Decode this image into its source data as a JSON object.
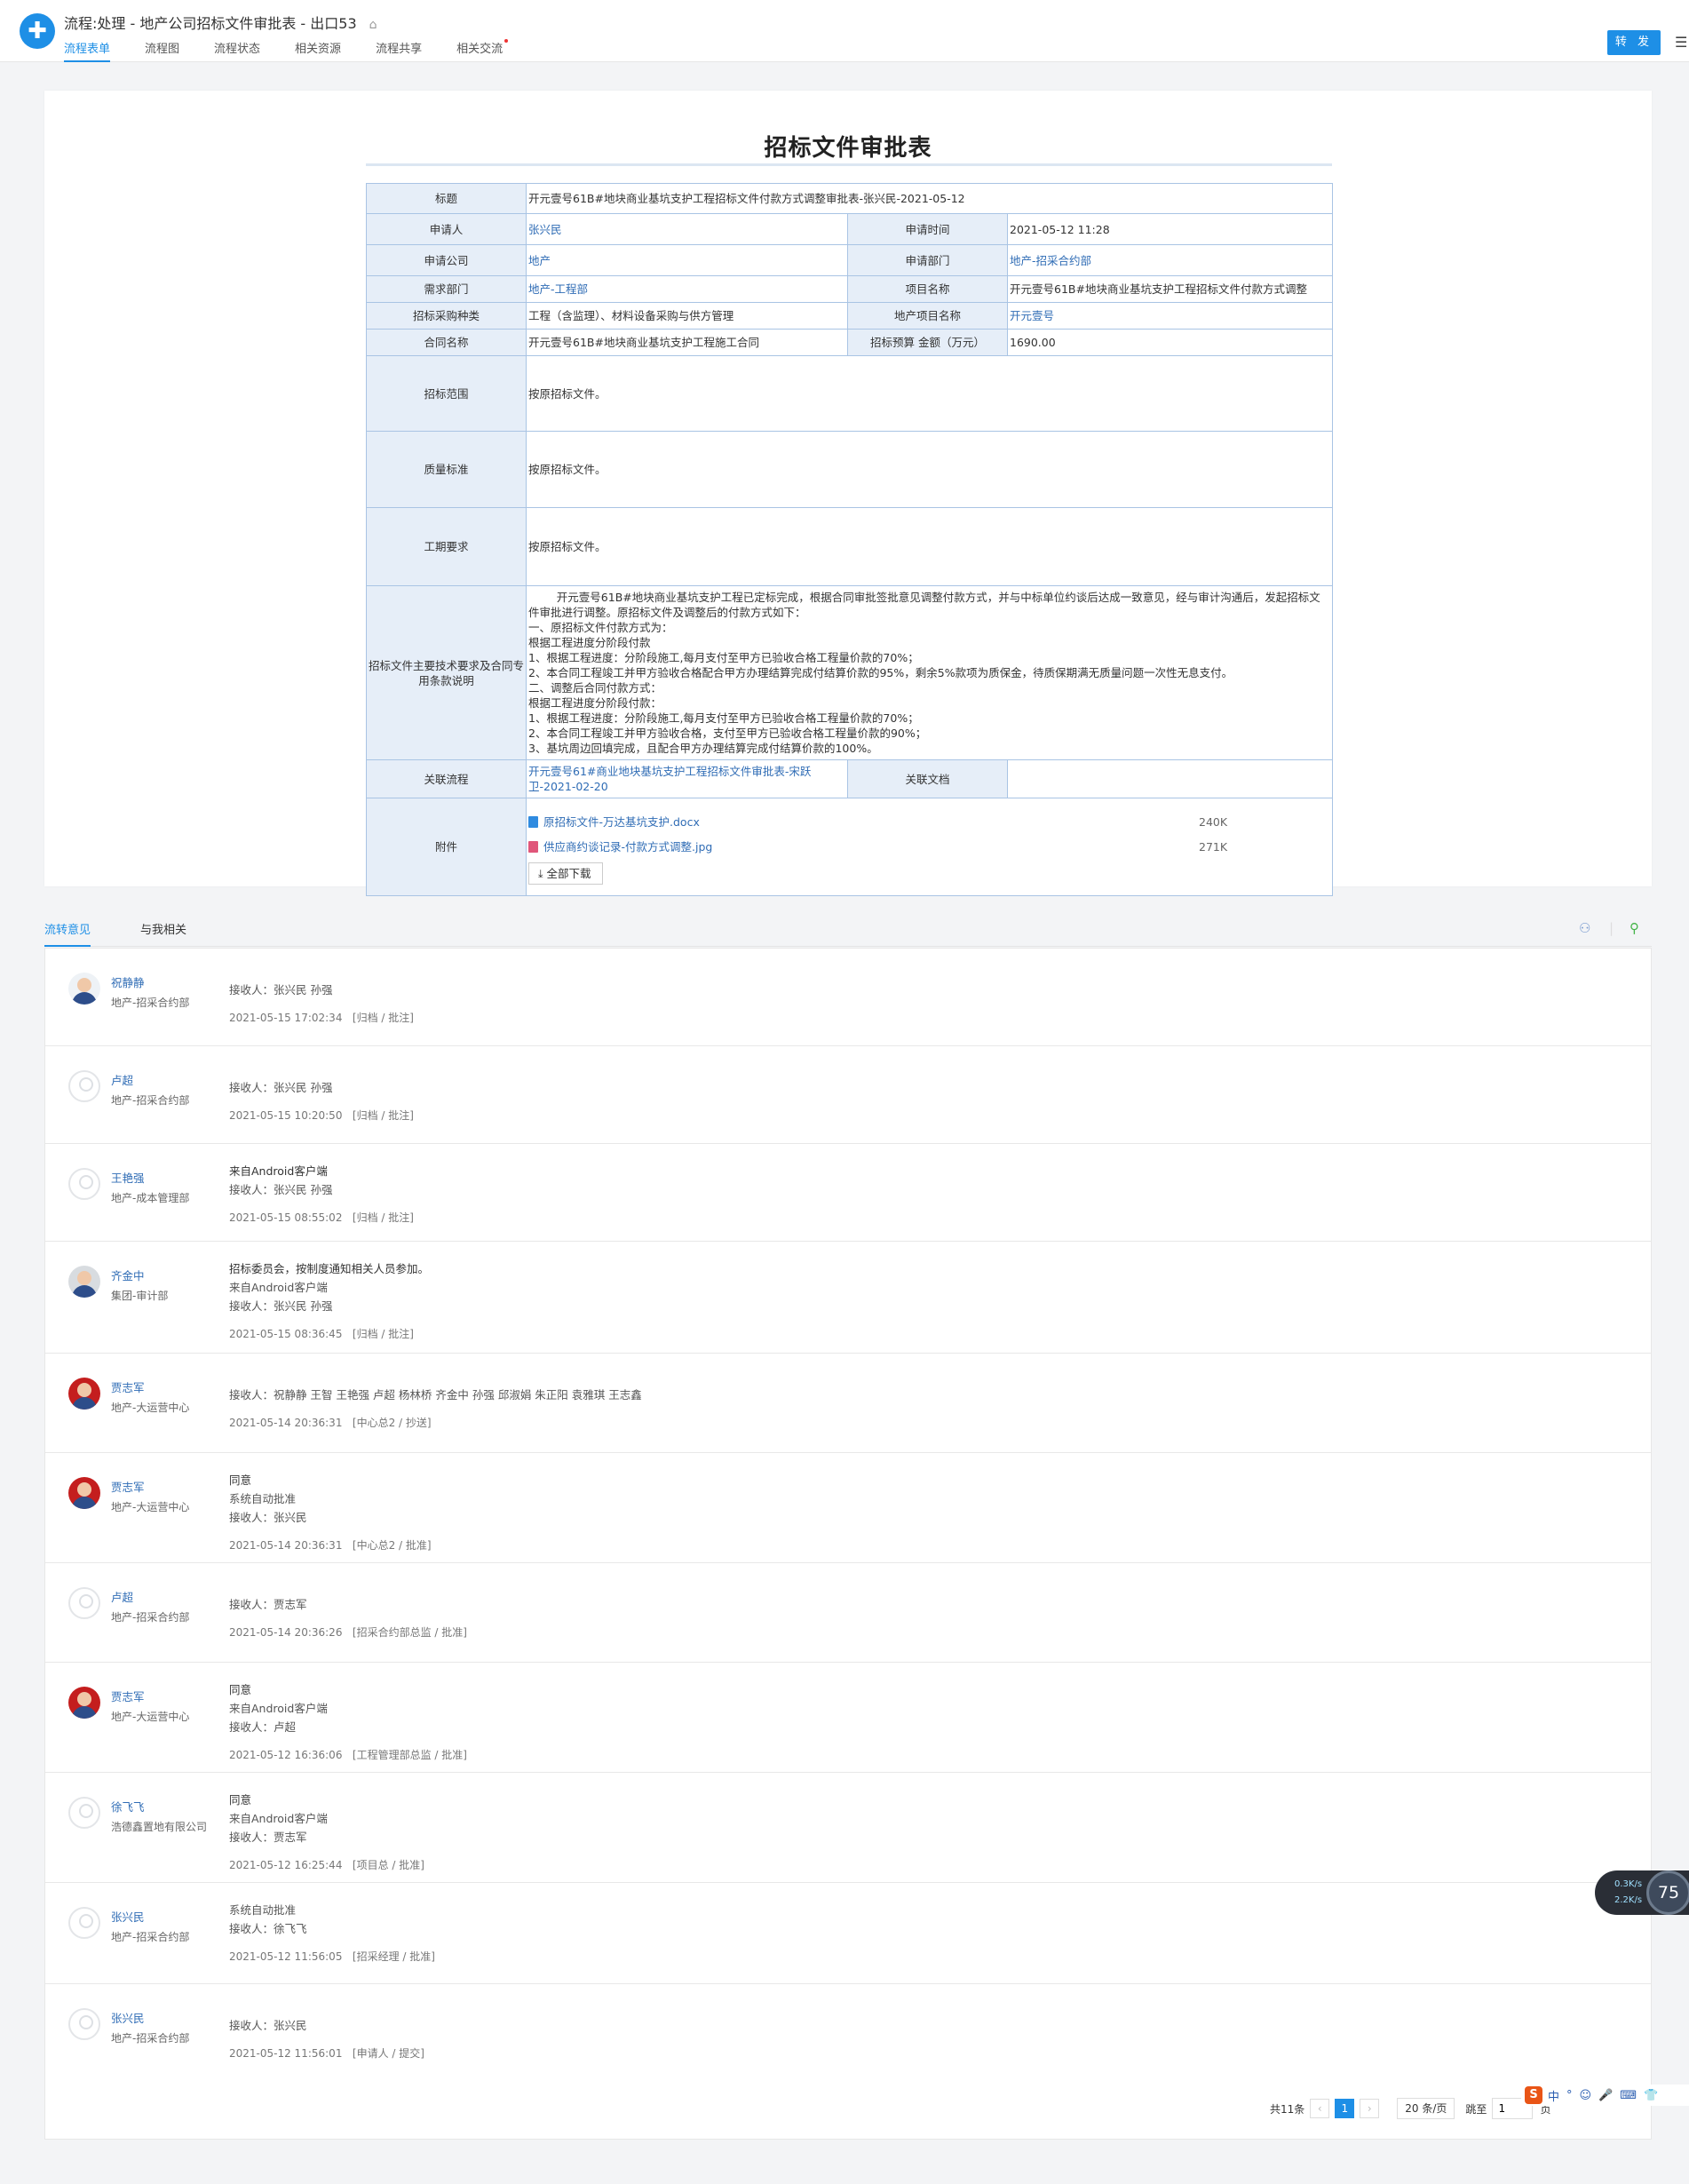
{
  "header": {
    "title": "流程:处理 - 地产公司招标文件审批表 - 出口53",
    "tabs": [
      "流程表单",
      "流程图",
      "流程状态",
      "相关资源",
      "流程共享",
      "相关交流"
    ],
    "forward_label": "转 发"
  },
  "form": {
    "title": "招标文件审批表",
    "labels": {
      "subject": "标题",
      "applicant": "申请人",
      "apply_time": "申请时间",
      "company": "申请公司",
      "dept": "申请部门",
      "req_dept": "需求部门",
      "project_name": "项目名称",
      "purchase_type": "招标采购种类",
      "re_project": "地产项目名称",
      "contract": "合同名称",
      "budget": "招标预算 金额（万元）",
      "scope": "招标范围",
      "quality": "质量标准",
      "duration": "工期要求",
      "tech": "招标文件主要技术要求及合同专用条款说明",
      "related_flow": "关联流程",
      "related_doc": "关联文档",
      "attachments": "附件"
    },
    "values": {
      "subject": "开元壹号61B#地块商业基坑支护工程招标文件付款方式调整审批表-张兴民-2021-05-12",
      "applicant": "张兴民",
      "apply_time": "2021-05-12 11:28",
      "company": "地产",
      "dept": "地产-招采合约部",
      "req_dept": "地产-工程部",
      "project_name": "开元壹号61B#地块商业基坑支护工程招标文件付款方式调整",
      "purchase_type": "工程（含监理）、材料设备采购与供方管理",
      "re_project": "开元壹号",
      "contract": "开元壹号61B#地块商业基坑支护工程施工合同",
      "budget": "1690.00",
      "scope": "按原招标文件。",
      "quality": "按原招标文件。",
      "duration": "按原招标文件。",
      "tech": "        开元壹号61B#地块商业基坑支护工程已定标完成，根据合同审批签批意见调整付款方式，并与中标单位约谈后达成一致意见，经与审计沟通后，发起招标文件审批进行调整。原招标文件及调整后的付款方式如下：\n一、原招标文件付款方式为：\n根据工程进度分阶段付款\n1、根据工程进度：分阶段施工,每月支付至甲方已验收合格工程量价款的70%；\n2、本合同工程竣工并甲方验收合格配合甲方办理结算完成付结算价款的95%，剩余5%款项为质保金，待质保期满无质量问题一次性无息支付。\n二、调整后合同付款方式：\n根据工程进度分阶段付款：\n1、根据工程进度：分阶段施工,每月支付至甲方已验收合格工程量价款的70%；\n2、本合同工程竣工并甲方验收合格，支付至甲方已验收合格工程量价款的90%；\n3、基坑周边回填完成，且配合甲方办理结算完成付结算价款的100%。",
      "related_flow": "开元壹号61#商业地块基坑支护工程招标文件审批表-宋跃卫-2021-02-20",
      "related_doc": ""
    },
    "attachments": [
      {
        "name": "原招标文件-万达基坑支护.docx",
        "size": "240K",
        "color": "#2f8be0"
      },
      {
        "name": "供应商约谈记录-付款方式调整.jpg",
        "size": "271K",
        "color": "#e0567a"
      }
    ],
    "download_all": "全部下载"
  },
  "opinions_tabs": [
    "流转意见",
    "与我相关"
  ],
  "opinions": [
    {
      "name": "祝静静",
      "dept": "地产-招采合约部",
      "lines": [],
      "receivers": "接收人：张兴民 孙强",
      "time": "2021-05-15 17:02:34",
      "action": "[归档 / 批注]",
      "avatar": "white"
    },
    {
      "name": "卢超",
      "dept": "地产-招采合约部",
      "lines": [],
      "receivers": "接收人：张兴民 孙强",
      "time": "2021-05-15 10:20:50",
      "action": "[归档 / 批注]",
      "avatar": "ph"
    },
    {
      "name": "王艳强",
      "dept": "地产-成本管理部",
      "lines": [
        "来自Android客户端"
      ],
      "receivers": "接收人：张兴民 孙强",
      "time": "2021-05-15 08:55:02",
      "action": "[归档 / 批注]",
      "avatar": "ph"
    },
    {
      "name": "齐金中",
      "dept": "集团-审计部",
      "lines": [
        "招标委员会，按制度通知相关人员参加。",
        "来自Android客户端"
      ],
      "receivers": "接收人：张兴民 孙强",
      "time": "2021-05-15 08:36:45",
      "action": "[归档 / 批注]",
      "avatar": "photo"
    },
    {
      "name": "贾志军",
      "dept": "地产-大运营中心",
      "lines": [],
      "receivers": "接收人：祝静静 王智 王艳强 卢超 杨林桥 齐金中 孙强 邱淑娟 朱正阳 袁雅琪 王志鑫",
      "time": "2021-05-14 20:36:31",
      "action": "[中心总2 / 抄送]",
      "avatar": "red"
    },
    {
      "name": "贾志军",
      "dept": "地产-大运营中心",
      "lines": [
        "同意",
        "系统自动批准"
      ],
      "receivers": "接收人：张兴民",
      "time": "2021-05-14 20:36:31",
      "action": "[中心总2 / 批准]",
      "avatar": "red"
    },
    {
      "name": "卢超",
      "dept": "地产-招采合约部",
      "lines": [],
      "receivers": "接收人：贾志军",
      "time": "2021-05-14 20:36:26",
      "action": "[招采合约部总监 / 批准]",
      "avatar": "ph"
    },
    {
      "name": "贾志军",
      "dept": "地产-大运营中心",
      "lines": [
        "同意",
        "来自Android客户端"
      ],
      "receivers": "接收人：卢超",
      "time": "2021-05-12 16:36:06",
      "action": "[工程管理部总监 / 批准]",
      "avatar": "red"
    },
    {
      "name": "徐飞飞",
      "dept": "浩德鑫置地有限公司",
      "lines": [
        "同意",
        "来自Android客户端"
      ],
      "receivers": "接收人：贾志军",
      "time": "2021-05-12 16:25:44",
      "action": "[项目总 / 批准]",
      "avatar": "ph"
    },
    {
      "name": "张兴民",
      "dept": "地产-招采合约部",
      "lines": [
        "系统自动批准"
      ],
      "receivers": "接收人：徐飞飞",
      "time": "2021-05-12 11:56:05",
      "action": "[招采经理 / 批准]",
      "avatar": "ph"
    },
    {
      "name": "张兴民",
      "dept": "地产-招采合约部",
      "lines": [],
      "receivers": "接收人：张兴民",
      "time": "2021-05-12 11:56:01",
      "action": "[申请人 / 提交]",
      "avatar": "ph"
    }
  ],
  "pager": {
    "total": "共11条",
    "current": "1",
    "per_page": "20 条/页",
    "goto": "跳至",
    "goto_value": "1",
    "page_unit": "页"
  },
  "net": {
    "up": "0.3K/s",
    "down": "2.2K/s",
    "percent": "75"
  },
  "ime": {
    "s_label": "S",
    "items": [
      "中",
      "°",
      "☺",
      "🎤",
      "⌨",
      "👕"
    ]
  }
}
